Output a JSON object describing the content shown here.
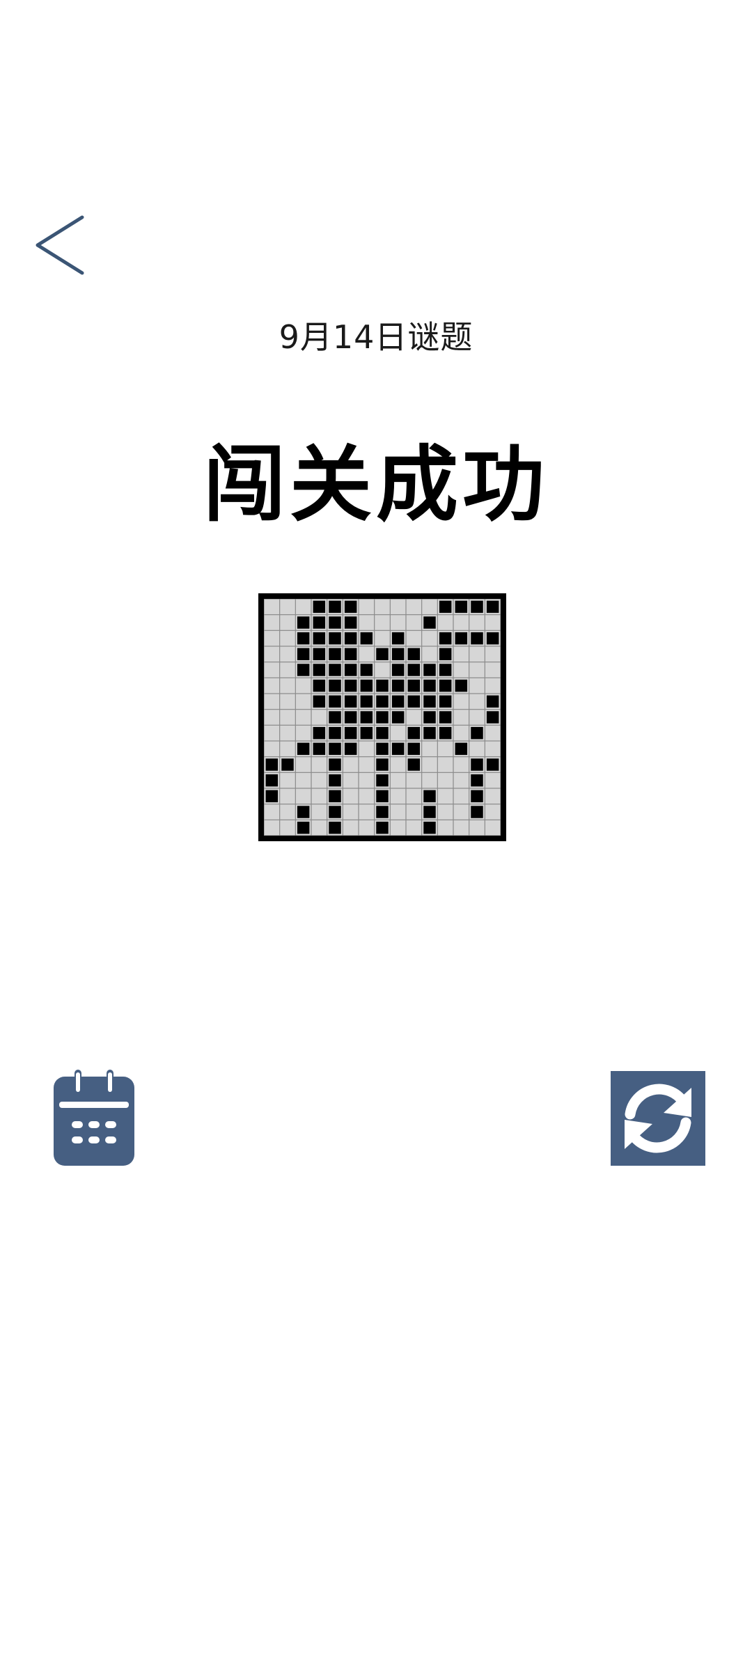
{
  "header": {
    "back_icon": "chevron-left-icon",
    "puzzle_date": "9月14日谜题"
  },
  "result": {
    "title": "闯关成功"
  },
  "puzzle": {
    "rows": 15,
    "cols": 15,
    "filled_color": "#000000",
    "empty_color": "#d6d6d6",
    "grid": [
      "...###.....####",
      "..####....#....",
      "..#####.#..####",
      "..####.###.#...",
      "..#####.####...",
      "...##########..",
      "...#########..#",
      "....#####.##..#",
      "...#####.###.#.",
      "..####.###..#..",
      "##..#..#.#...##",
      "#...#..#.....#.",
      "#...#..#..#..#.",
      "..#.#..#..#..#.",
      "..#.#..#..#...."
    ]
  },
  "actions": {
    "calendar_icon": "calendar-icon",
    "refresh_icon": "refresh-icon",
    "accent_color": "#465f82",
    "icon_color": "#ffffff"
  }
}
